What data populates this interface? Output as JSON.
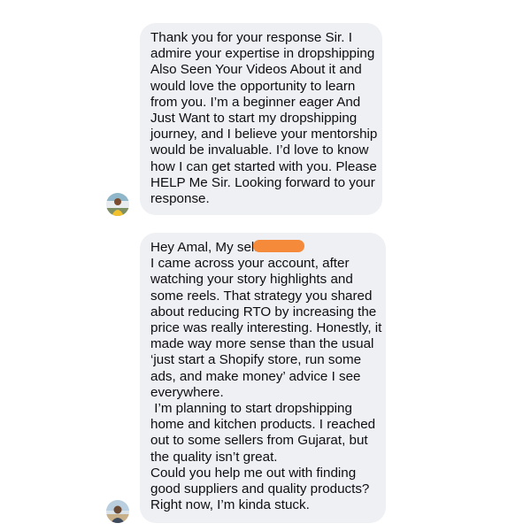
{
  "messages": [
    {
      "sender": "other",
      "lines": [
        "Thank you for your response Sir. I",
        "admire your expertise in dropshipping",
        "Also Seen Your Videos About it and",
        "would love the opportunity to learn",
        "from you. I’m a beginner eager And",
        "Just Want to start my dropshipping",
        "journey, and I believe your mentorship",
        "would be invaluable. I’d love to know",
        "how I can get started with you. Please",
        "HELP Me Sir. Looking forward to your",
        "response."
      ]
    },
    {
      "sender": "other",
      "lines": [
        "Hey Amal, My self",
        "I came across your account, after",
        "watching your story highlights and",
        "some reels. That strategy you shared",
        "about reducing RTO by increasing the",
        "price was really interesting. Honestly, it",
        "made way more sense than the usual",
        "‘just start a Shopify store, run some",
        "ads, and make money’ advice I see",
        "everywhere.",
        " I’m planning to start dropshipping",
        "home and kitchen products. I reached",
        "out to some sellers from Gujarat, but",
        "the quality isn’t great.",
        "Could you help me out with finding",
        "good suppliers and quality products?",
        "Right now, I’m kinda stuck."
      ]
    }
  ],
  "colors": {
    "bubble": "#eff0f4",
    "text": "#0e0e10",
    "redaction": "#f48a3a"
  }
}
